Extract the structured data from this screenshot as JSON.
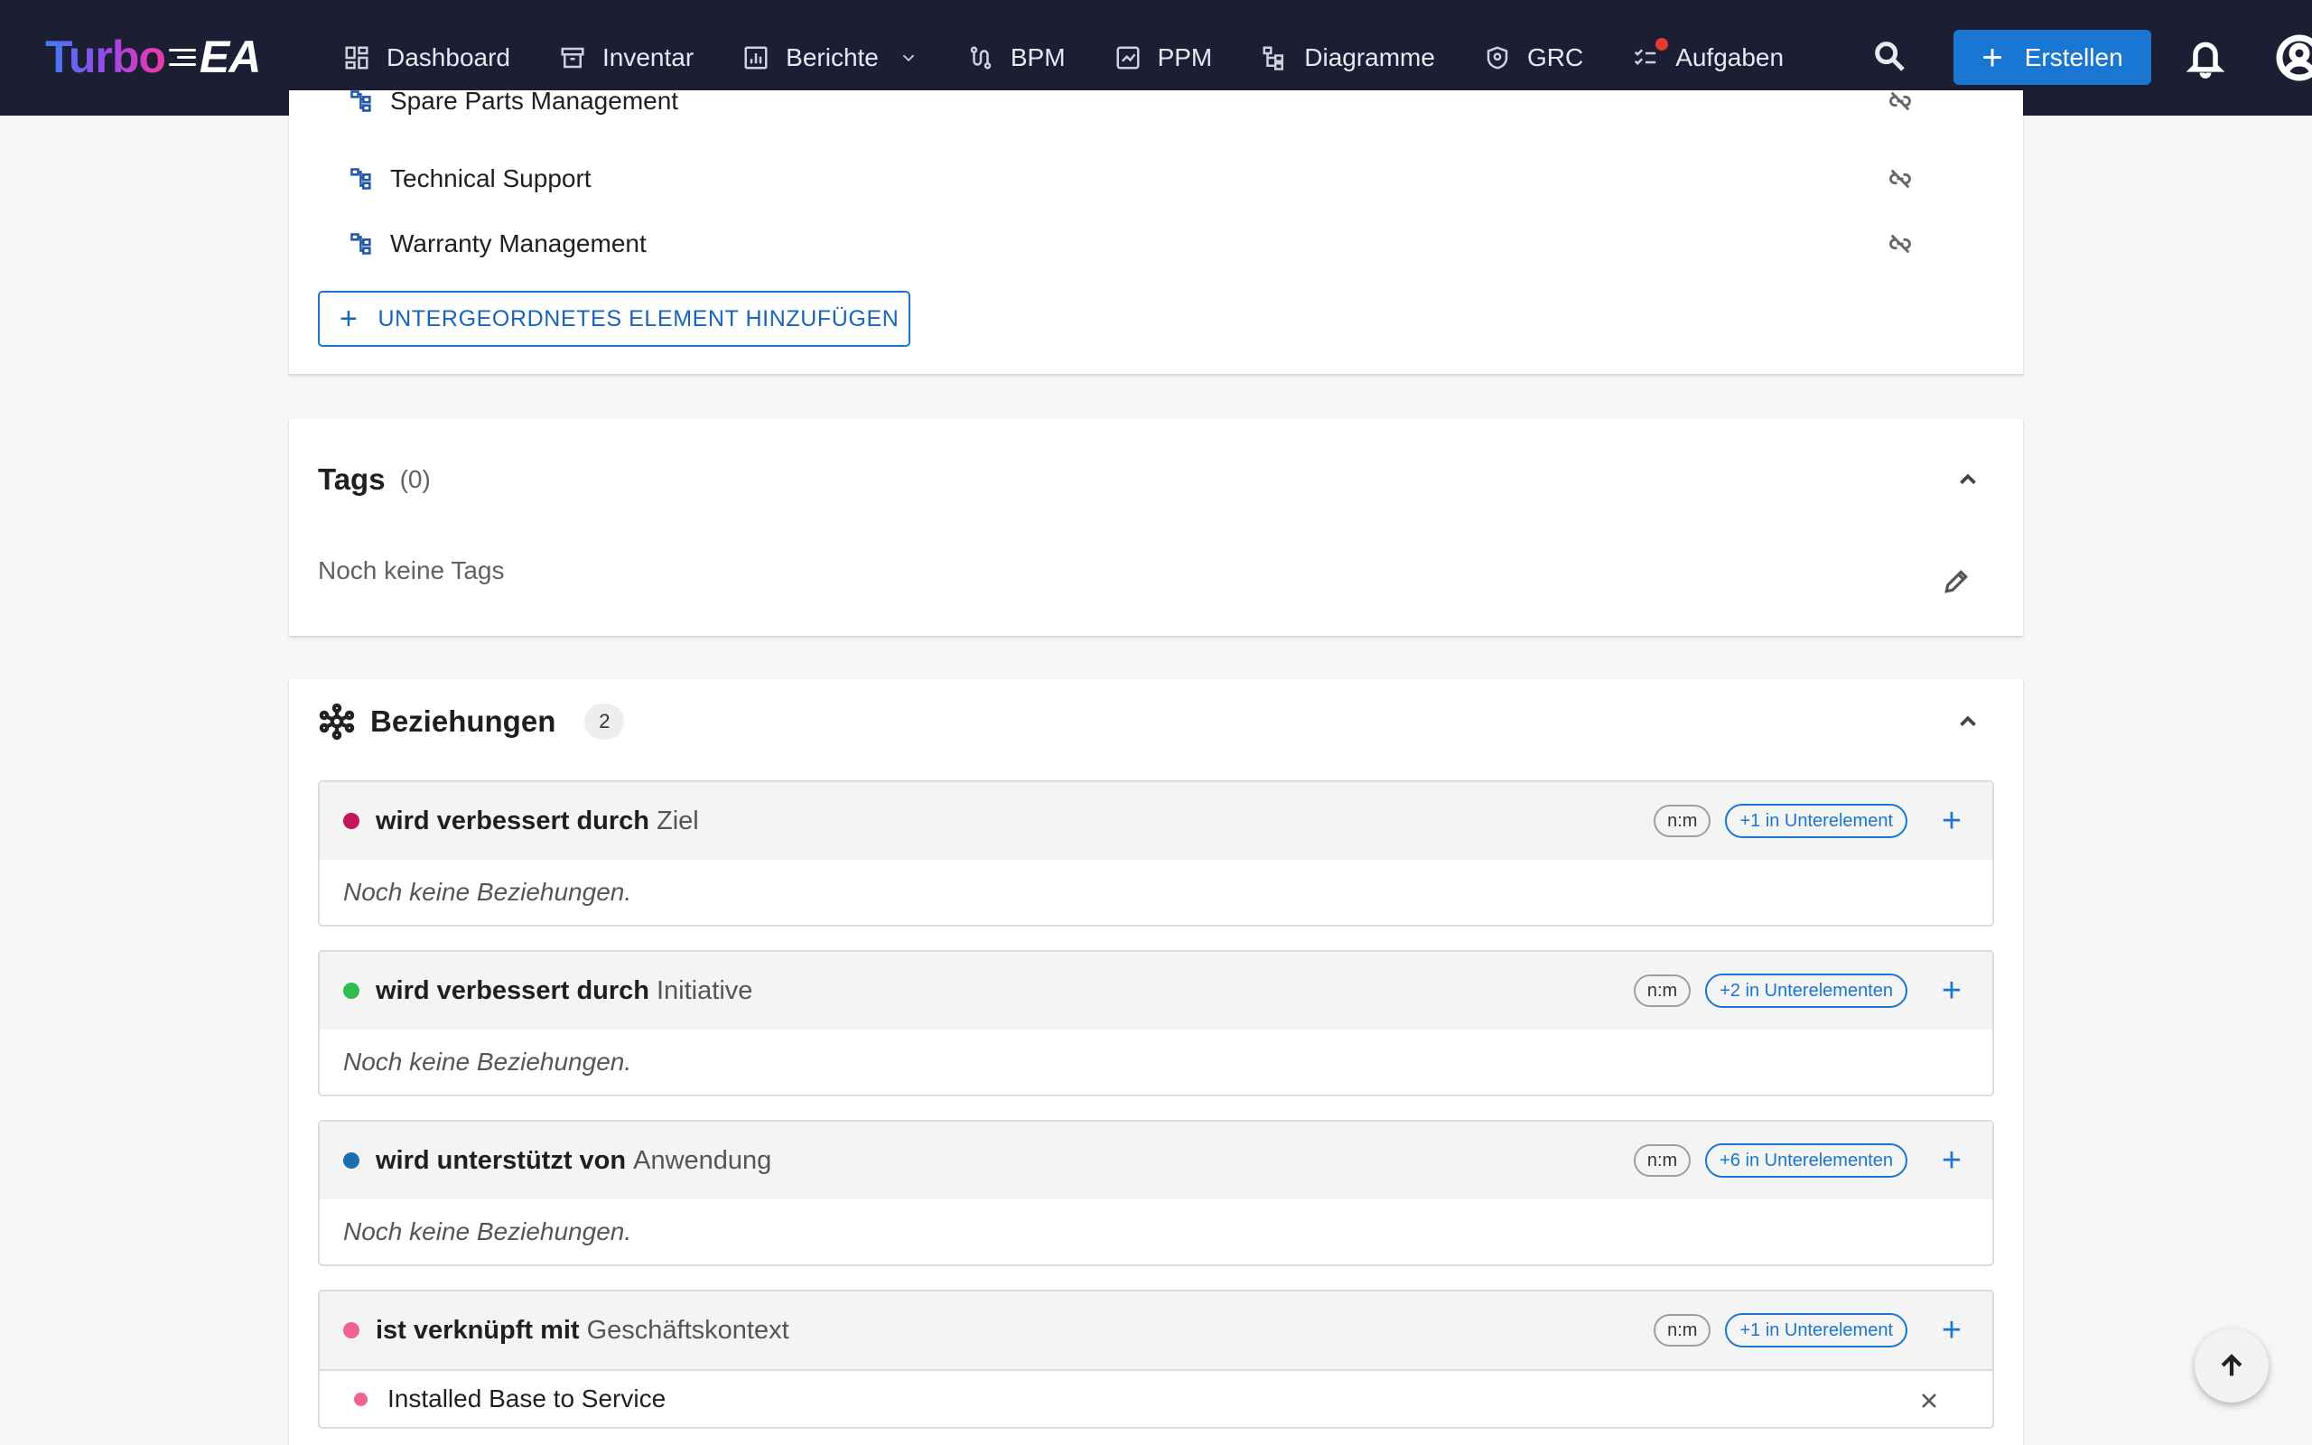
{
  "app": {
    "logo_turbo": "Turbo",
    "logo_ea": "EA"
  },
  "nav": {
    "items": [
      {
        "label": "Dashboard",
        "icon": "dashboard-icon"
      },
      {
        "label": "Inventar",
        "icon": "archive-icon"
      },
      {
        "label": "Berichte",
        "icon": "report-icon",
        "has_dropdown": true
      },
      {
        "label": "BPM",
        "icon": "route-icon"
      },
      {
        "label": "PPM",
        "icon": "portfolio-icon"
      },
      {
        "label": "Diagramme",
        "icon": "diagram-icon"
      },
      {
        "label": "GRC",
        "icon": "shield-icon"
      },
      {
        "label": "Aufgaben",
        "icon": "tasks-icon",
        "has_notification": true
      }
    ],
    "create_label": "Erstellen"
  },
  "children": {
    "items": [
      {
        "label": "Spare Parts Management"
      },
      {
        "label": "Technical Support"
      },
      {
        "label": "Warranty Management"
      }
    ],
    "add_label": "UNTERGEORDNETES ELEMENT HINZUFÜGEN"
  },
  "tags": {
    "title": "Tags",
    "count": "(0)",
    "empty_text": "Noch keine Tags"
  },
  "relations": {
    "title": "Beziehungen",
    "count": "2",
    "groups": [
      {
        "label": "wird verbessert durch",
        "target": "Ziel",
        "color": "#c2185b",
        "cardinality": "n:m",
        "sub_count": "+1 in Unterelement",
        "empty": "Noch keine Beziehungen."
      },
      {
        "label": "wird verbessert durch",
        "target": "Initiative",
        "color": "#2ebd4f",
        "cardinality": "n:m",
        "sub_count": "+2 in Unterelementen",
        "empty": "Noch keine Beziehungen."
      },
      {
        "label": "wird unterstützt von",
        "target": "Anwendung",
        "color": "#1b6fb0",
        "cardinality": "n:m",
        "sub_count": "+6 in Unterelementen",
        "empty": "Noch keine Beziehungen."
      },
      {
        "label": "ist verknüpft mit",
        "target": "Geschäftskontext",
        "color": "#f06292",
        "cardinality": "n:m",
        "sub_count": "+1 in Unterelement",
        "item": "Installed Base to Service"
      }
    ]
  }
}
